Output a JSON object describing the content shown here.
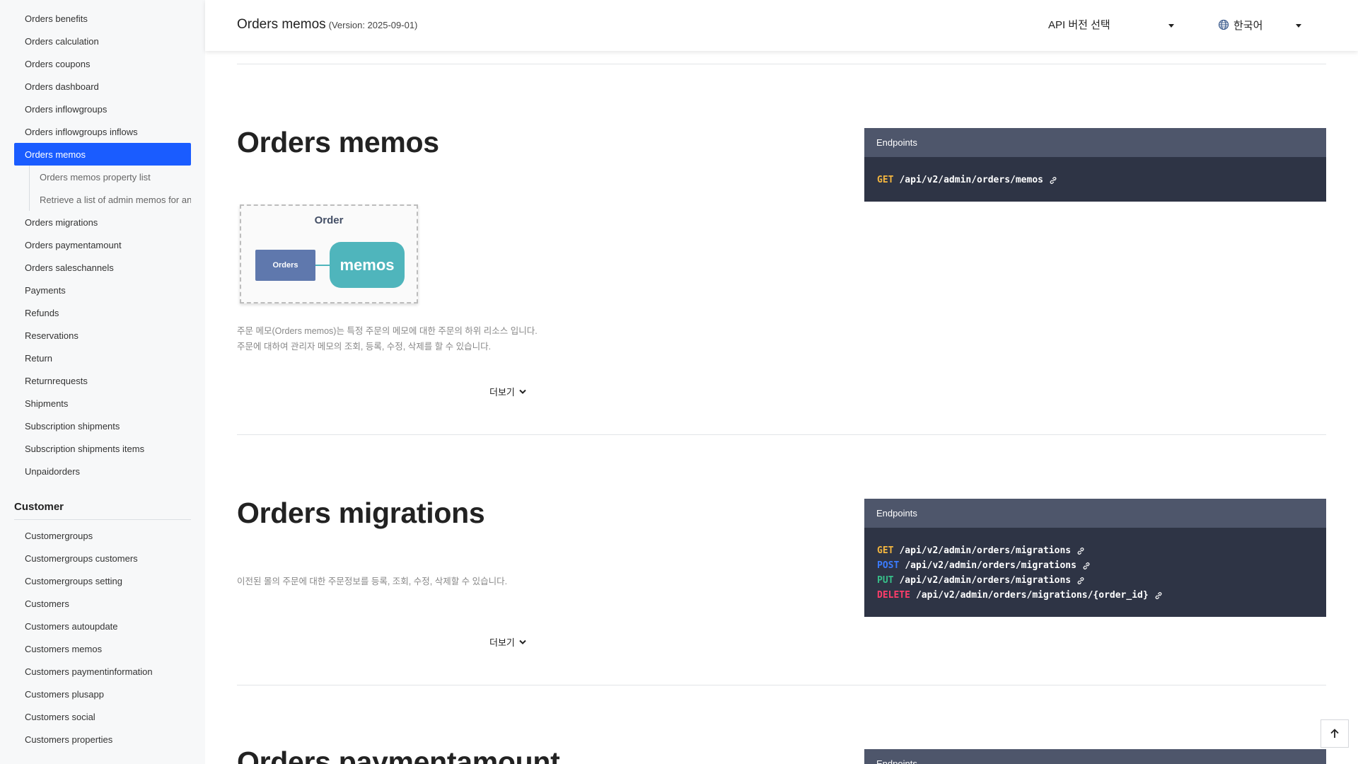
{
  "sidebar": {
    "items_top": [
      {
        "label": "Orders benefits"
      },
      {
        "label": "Orders calculation"
      },
      {
        "label": "Orders coupons"
      },
      {
        "label": "Orders dashboard"
      },
      {
        "label": "Orders inflowgroups"
      },
      {
        "label": "Orders inflowgroups inflows"
      },
      {
        "label": "Orders memos",
        "active": true
      }
    ],
    "sub_items": [
      {
        "label": "Orders memos property list"
      },
      {
        "label": "Retrieve a list of admin memos for an order"
      }
    ],
    "items_rest": [
      {
        "label": "Orders migrations"
      },
      {
        "label": "Orders paymentamount"
      },
      {
        "label": "Orders saleschannels"
      },
      {
        "label": "Payments"
      },
      {
        "label": "Refunds"
      },
      {
        "label": "Reservations"
      },
      {
        "label": "Return"
      },
      {
        "label": "Returnrequests"
      },
      {
        "label": "Shipments"
      },
      {
        "label": "Subscription shipments"
      },
      {
        "label": "Subscription shipments items"
      },
      {
        "label": "Unpaidorders"
      }
    ],
    "customer_heading": "Customer",
    "customer_items": [
      {
        "label": "Customergroups"
      },
      {
        "label": "Customergroups customers"
      },
      {
        "label": "Customergroups setting"
      },
      {
        "label": "Customers"
      },
      {
        "label": "Customers autoupdate"
      },
      {
        "label": "Customers memos"
      },
      {
        "label": "Customers paymentinformation"
      },
      {
        "label": "Customers plusapp"
      },
      {
        "label": "Customers social"
      },
      {
        "label": "Customers properties"
      }
    ]
  },
  "header": {
    "title": "Orders memos",
    "version": "(Version: 2025-09-01)",
    "api_select_label": "API 버전 선택",
    "language_label": "한국어"
  },
  "sections": {
    "memos": {
      "title": "Orders memos",
      "endpoints_label": "Endpoints",
      "endpoints": [
        {
          "method": "GET",
          "path": "/api/v2/admin/orders/memos"
        }
      ],
      "diagram": {
        "title": "Order",
        "parent": "Orders",
        "child": "memos"
      },
      "desc_line1": "주문 메모(Orders memos)는 특정 주문의 메모에 대한 주문의 하위 리소스 입니다.",
      "desc_line2": "주문에 대하여 관리자 메모의 조회, 등록, 수정, 삭제를 할 수 있습니다.",
      "more_label": "더보기"
    },
    "migrations": {
      "title": "Orders migrations",
      "endpoints_label": "Endpoints",
      "endpoints": [
        {
          "method": "GET",
          "path": "/api/v2/admin/orders/migrations"
        },
        {
          "method": "POST",
          "path": "/api/v2/admin/orders/migrations"
        },
        {
          "method": "PUT",
          "path": "/api/v2/admin/orders/migrations"
        },
        {
          "method": "DELETE",
          "path": "/api/v2/admin/orders/migrations/{order_id}"
        }
      ],
      "desc": "이전된 몰의 주문에 대한 주문정보를 등록, 조회, 수정, 삭제할 수 있습니다.",
      "more_label": "더보기"
    },
    "paymentamount": {
      "title": "Orders paymentamount",
      "endpoints_label": "Endpoints"
    }
  },
  "colors": {
    "accent": "#1a5cff",
    "endpoint_bg": "#2e3445",
    "endpoint_head": "#4e566b",
    "get": "#f4b63f",
    "post": "#3b7cff",
    "put": "#37c08a",
    "delete": "#ff3d6a"
  },
  "icons": {
    "globe": "globe-icon",
    "caret": "caret-down-icon",
    "link": "link-icon",
    "chevron": "chevron-down-icon",
    "scroll_top": "arrow-up-icon"
  }
}
